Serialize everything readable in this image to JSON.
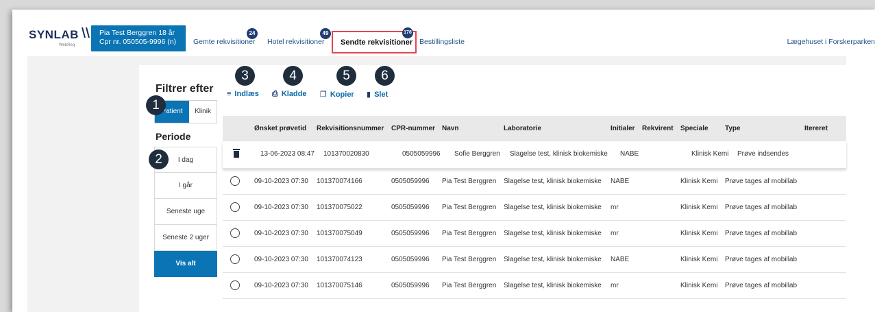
{
  "header": {
    "logo_brand": "SYNLAB",
    "logo_sub": "WebReq",
    "patient_name": "Pia Test Berggren 18 år",
    "patient_cpr": "Cpr nr. 050505-9996 (n)",
    "nav": [
      {
        "label": "Gemte rekvisitioner",
        "badge": "24"
      },
      {
        "label": "Hotel rekvisitioner",
        "badge": "49"
      },
      {
        "label": "Sendte rekvisitioner",
        "badge": "178"
      },
      {
        "label": "Bestillingsliste"
      }
    ],
    "clinic": "Lægehuset i Forskerparken"
  },
  "filter": {
    "title": "Filtrer efter",
    "toggle": [
      "Patient",
      "Klinik"
    ],
    "periode_title": "Periode",
    "periods": [
      "I dag",
      "I går",
      "Seneste uge",
      "Seneste 2 uger",
      "Vis alt"
    ]
  },
  "callouts": [
    "1",
    "2",
    "3",
    "4",
    "5",
    "6"
  ],
  "actions": {
    "indlaes": "Indlæs",
    "kladde": "Kladde",
    "kopier": "Kopier",
    "slet": "Slet"
  },
  "table": {
    "columns": [
      "Ønsket prøvetid",
      "Rekvisitionsnummer",
      "CPR-nummer",
      "Navn",
      "Laboratorie",
      "Initialer",
      "Rekvirent",
      "Speciale",
      "Type",
      "Itereret"
    ],
    "rows": [
      [
        "13-06-2023 08:47",
        "101370020830",
        "0505059996",
        "Sofie Berggren",
        "Slagelse test, klinisk biokemiske",
        "NABE",
        "",
        "Klinisk Kemi",
        "Prøve indsendes"
      ],
      [
        "09-10-2023 07:30",
        "101370074166",
        "0505059996",
        "Pia Test Berggren",
        "Slagelse test, klinisk biokemiske",
        "NABE",
        "",
        "Klinisk Kemi",
        "Prøve tages af mobillab"
      ],
      [
        "09-10-2023 07:30",
        "101370075022",
        "0505059996",
        "Pia Test Berggren",
        "Slagelse test, klinisk biokemiske",
        "mr",
        "",
        "Klinisk Kemi",
        "Prøve tages af mobillab"
      ],
      [
        "09-10-2023 07:30",
        "101370075049",
        "0505059996",
        "Pia Test Berggren",
        "Slagelse test, klinisk biokemiske",
        "mr",
        "",
        "Klinisk Kemi",
        "Prøve tages af mobillab"
      ],
      [
        "09-10-2023 07:30",
        "101370074123",
        "0505059996",
        "Pia Test Berggren",
        "Slagelse test, klinisk biokemiske",
        "NABE",
        "",
        "Klinisk Kemi",
        "Prøve tages af mobillab"
      ],
      [
        "09-10-2023 07:30",
        "101370075146",
        "0505059996",
        "Pia Test Berggren",
        "Slagelse test, klinisk biokemiske",
        "mr",
        "",
        "Klinisk Kemi",
        "Prøve tages af mobillab"
      ]
    ]
  }
}
